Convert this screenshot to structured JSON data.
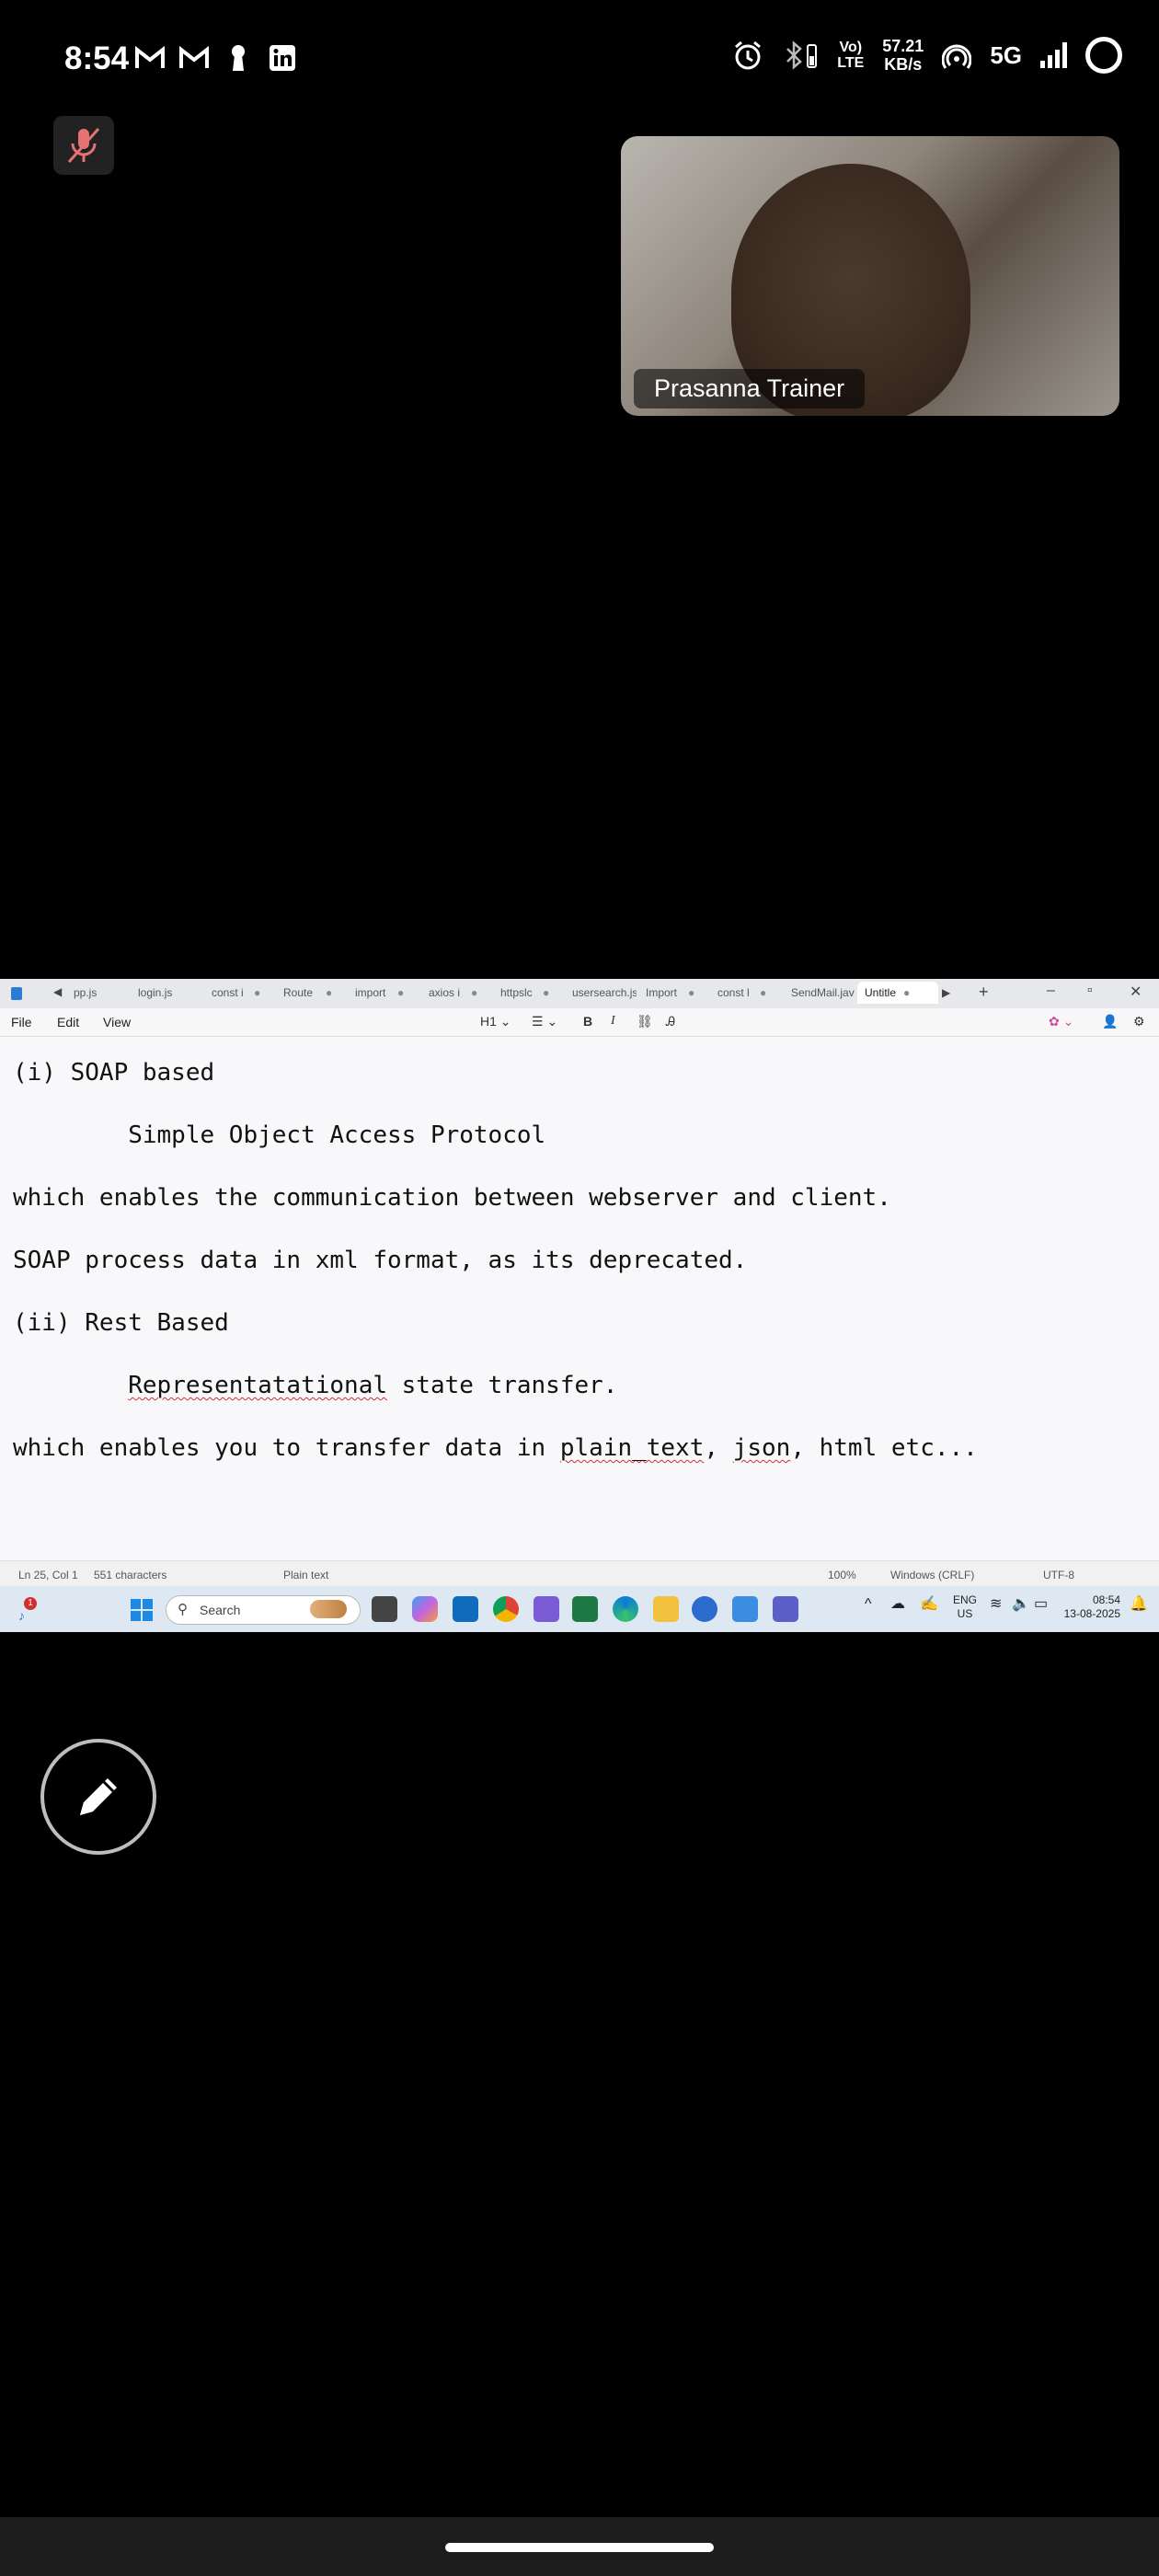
{
  "status_bar": {
    "time": "8:54",
    "notification_icons": [
      "gmail-icon",
      "gmail-icon",
      "keyhole-icon",
      "linkedin-icon"
    ],
    "volte": "Vo)\nLTE",
    "speed_value": "57.21",
    "speed_unit": "KB/s",
    "network": "5G"
  },
  "call": {
    "participant_name": "Prasanna Trainer",
    "mic_state": "muted"
  },
  "notepad": {
    "tabs": [
      "pp.js",
      "login.js",
      "const i",
      "Route",
      "import",
      "axios i",
      "httpslc",
      "usersearch.js",
      "Import",
      "const l",
      "SendMail.jav",
      "Untitle"
    ],
    "active_tab": "Untitle",
    "menu": [
      "File",
      "Edit",
      "View"
    ],
    "heading_selector": "H1",
    "lines": [
      {
        "text": "(i) SOAP based"
      },
      {
        "text": "        Simple Object Access Protocol"
      },
      {
        "text": "which enables the communication between webserver and client."
      },
      {
        "text": "SOAP process data in xml format, as its deprecated."
      },
      {
        "text": "(ii) Rest Based"
      },
      {
        "indent": "        ",
        "sq": "Representatational",
        "rest": " state transfer."
      },
      {
        "pre": "which enables you to transfer data in ",
        "sq1": "plain_text",
        "mid": ", ",
        "sq2": "json",
        "post": ", html etc..."
      }
    ],
    "status": {
      "position": "Ln 25, Col 1",
      "characters": "551 characters",
      "format": "Plain text",
      "zoom": "100%",
      "line_endings": "Windows (CRLF)",
      "encoding": "UTF-8"
    }
  },
  "taskbar": {
    "search_placeholder": "Search",
    "lang": "ENG",
    "region": "US",
    "clock_time": "08:54",
    "clock_date": "13-08-2025",
    "notification_badge": "1"
  },
  "colors": {
    "background": "#000000",
    "spell_underline": "#d32f2f",
    "mic_muted": "#e57373"
  }
}
